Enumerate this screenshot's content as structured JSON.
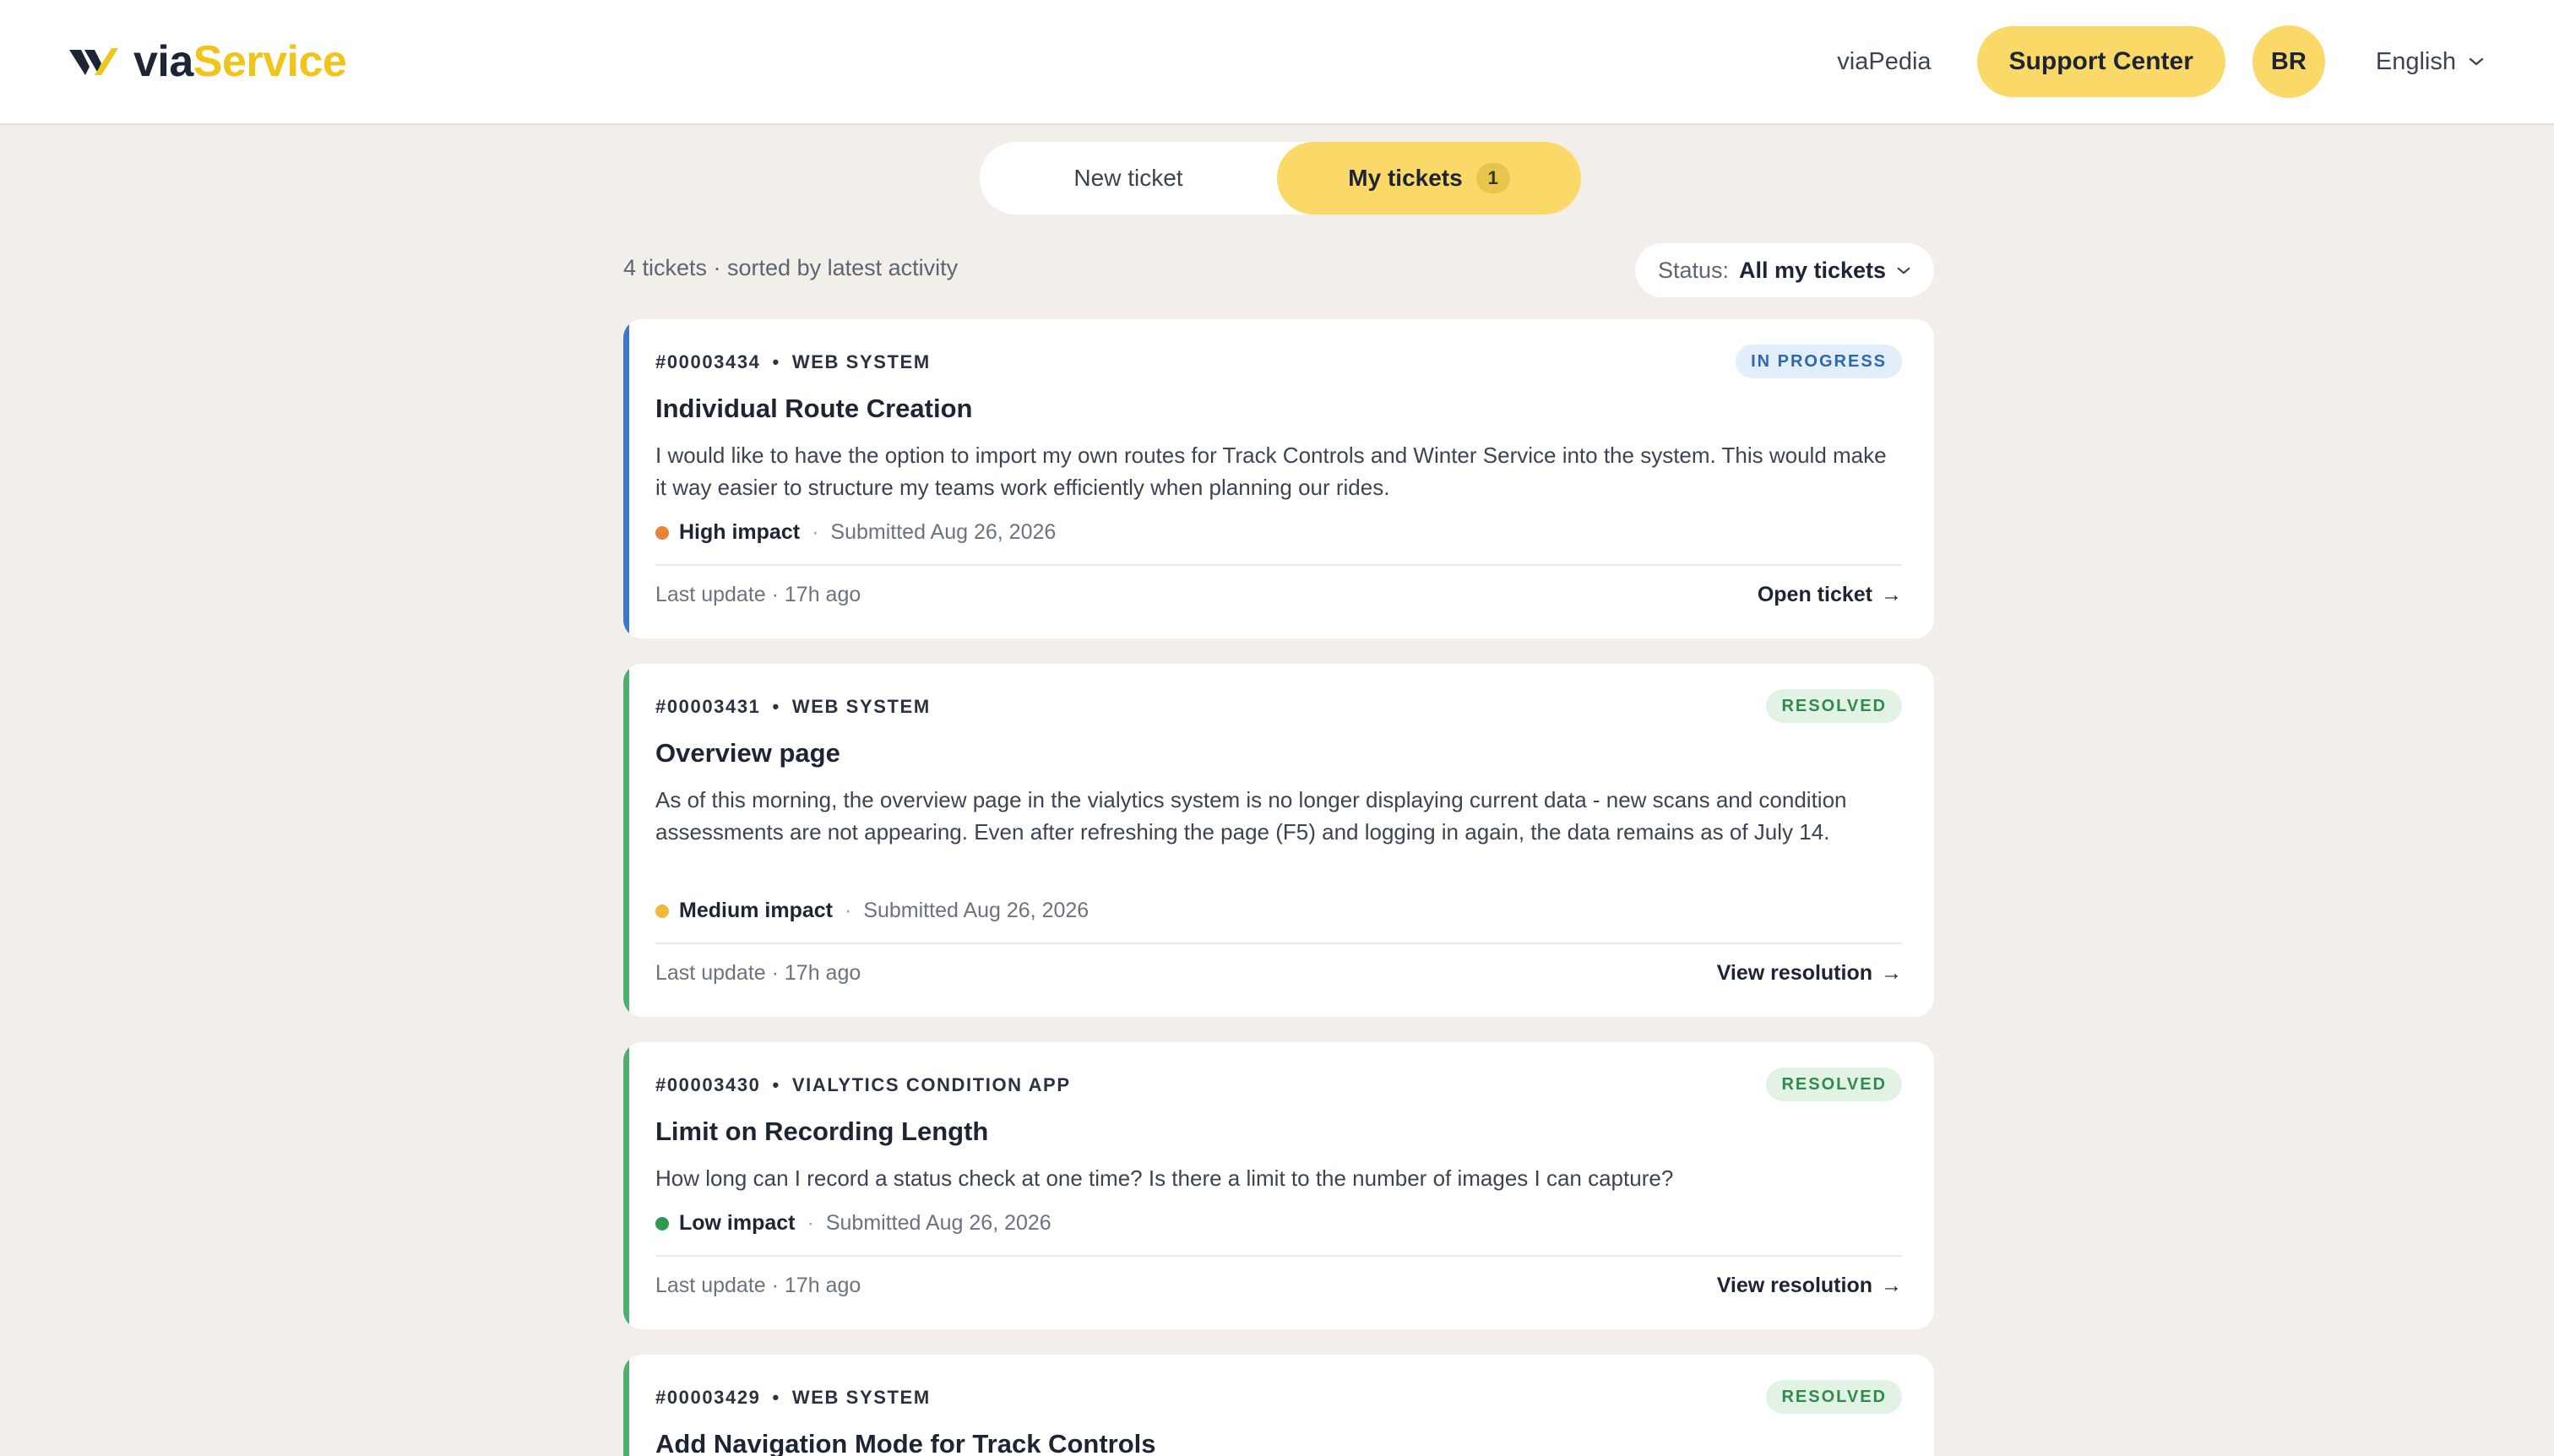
{
  "header": {
    "brand_via": "via",
    "brand_service": "Service",
    "nav_link": "viaPedia",
    "support_button": "Support Center",
    "avatar_initials": "BR",
    "language": "English"
  },
  "tabs": {
    "new_ticket": "New ticket",
    "my_tickets": "My tickets",
    "my_tickets_count": "1"
  },
  "summary": "4 tickets · sorted by latest activity",
  "status_filter": {
    "label": "Status:",
    "value": "All my tickets"
  },
  "colors": {
    "accent_yellow": "#fbd968",
    "in_progress": "#3a78c9",
    "resolved": "#4caf6e",
    "high_impact": "#e8833a",
    "medium_impact": "#f0b93a",
    "low_impact": "#2f9a55"
  },
  "tickets": [
    {
      "id": "#00003434",
      "category": "WEB SYSTEM",
      "status": "IN PROGRESS",
      "title": "Individual Route Creation",
      "description": "I would like to have the option to import my own routes for Track Controls and Winter Service into the system. This would make it way easier to structure my teams work efficiently when planning our rides.",
      "impact": "High impact",
      "submitted": "Submitted Aug 26, 2026",
      "last_update": "Last update · 17h ago",
      "action": "Open ticket"
    },
    {
      "id": "#00003431",
      "category": "WEB SYSTEM",
      "status": "RESOLVED",
      "title": "Overview page",
      "description": "As of this morning, the overview page in the vialytics system is no longer displaying current data - new scans and condition assessments are not appearing. Even after refreshing the page (F5) and logging in again, the data remains as of July 14.",
      "impact": "Medium impact",
      "submitted": "Submitted Aug 26, 2026",
      "last_update": "Last update · 17h ago",
      "action": "View resolution"
    },
    {
      "id": "#00003430",
      "category": "VIALYTICS CONDITION APP",
      "status": "RESOLVED",
      "title": "Limit on Recording Length",
      "description": "How long can I record a status check at one time? Is there a limit to the number of images I can capture?",
      "impact": "Low impact",
      "submitted": "Submitted Aug 26, 2026",
      "last_update": "Last update · 17h ago",
      "action": "View resolution"
    },
    {
      "id": "#00003429",
      "category": "WEB SYSTEM",
      "status": "RESOLVED",
      "title": "Add Navigation Mode for Track Controls"
    }
  ]
}
